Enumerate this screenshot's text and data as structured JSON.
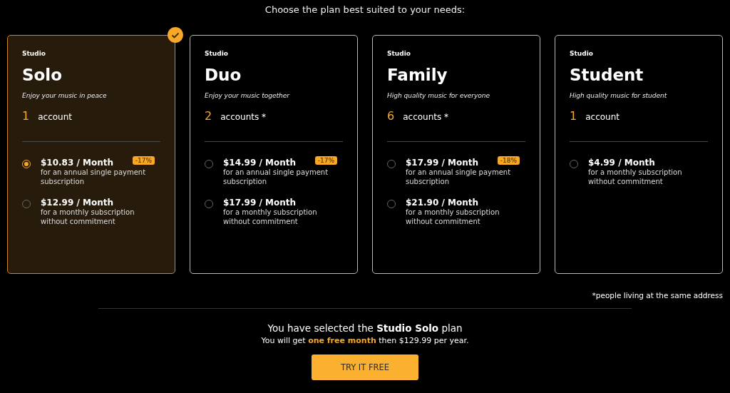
{
  "heading": "Choose the plan best suited to your needs:",
  "plans": [
    {
      "brand": "Studio",
      "name": "Solo",
      "tagline": "Enjoy your music in peace",
      "count": "1",
      "unit": "account",
      "selected": true,
      "options": [
        {
          "price": "$10.83 / Month",
          "description": "for an annual single payment subscription",
          "discount": "-17%",
          "selected": true
        },
        {
          "price": "$12.99 / Month",
          "description": "for a monthly subscription without commitment",
          "selected": false
        }
      ]
    },
    {
      "brand": "Studio",
      "name": "Duo",
      "tagline": "Enjoy your music together",
      "count": "2",
      "unit": "accounts *",
      "selected": false,
      "options": [
        {
          "price": "$14.99 / Month",
          "description": "for an annual single payment subscription",
          "discount": "-17%",
          "selected": false
        },
        {
          "price": "$17.99 / Month",
          "description": "for a monthly subscription without commitment",
          "selected": false
        }
      ]
    },
    {
      "brand": "Studio",
      "name": "Family",
      "tagline": "High quality music for everyone",
      "count": "6",
      "unit": "accounts *",
      "selected": false,
      "options": [
        {
          "price": "$17.99 / Month",
          "description": "for an annual single payment subscription",
          "discount": "-18%",
          "selected": false
        },
        {
          "price": "$21.90 / Month",
          "description": "for a monthly subscription without commitment",
          "selected": false
        }
      ]
    },
    {
      "brand": "Studio",
      "name": "Student",
      "tagline": "High quality music for student",
      "count": "1",
      "unit": "account",
      "selected": false,
      "options": [
        {
          "price": "$4.99 / Month",
          "description": "for a monthly subscription without commitment",
          "selected": false
        }
      ]
    }
  ],
  "footnote": "*people living at the same address",
  "summary": {
    "selection": "You have selected the **Studio Solo** plan",
    "offer": "You will get **one free month** then $129.99 per year.",
    "button": "TRY IT FREE"
  }
}
